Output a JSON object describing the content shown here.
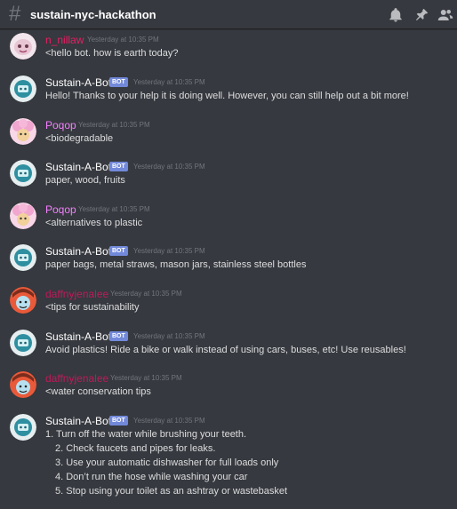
{
  "channel": {
    "name": "sustain-nyc-hackathon"
  },
  "colors": {
    "bot_name": "#ffffff",
    "niliaw": "#e91e63",
    "poqop": "#f47fff",
    "daffny": "#c2185b",
    "bot_badge": "#7289da"
  },
  "icons": [
    "bell-icon",
    "pin-icon",
    "members-icon"
  ],
  "messages": [
    {
      "author": "n_nillaw",
      "time": "Yesterday at 10:35 PM",
      "text": "<hello bot. how is earth today?"
    },
    {
      "author": "Sustain-A-Bot",
      "badge": "BOT",
      "time": "Yesterday at 10:35 PM",
      "text": "Hello! Thanks to your help it is doing well. However, you can still help out a bit more!"
    },
    {
      "author": "Poqop",
      "time": "Yesterday at 10:35 PM",
      "text": "<biodegradable"
    },
    {
      "author": "Sustain-A-Bot",
      "badge": "BOT",
      "time": "Yesterday at 10:35 PM",
      "text": "paper, wood, fruits"
    },
    {
      "author": "Poqop",
      "time": "Yesterday at 10:35 PM",
      "text": "<alternatives to plastic"
    },
    {
      "author": "Sustain-A-Bot",
      "badge": "BOT",
      "time": "Yesterday at 10:35 PM",
      "text": "paper bags, metal straws, mason jars, stainless steel bottles"
    },
    {
      "author": "daffnyjenalee",
      "time": "Yesterday at 10:35 PM",
      "text": "<tips for sustainability"
    },
    {
      "author": "Sustain-A-Bot",
      "badge": "BOT",
      "time": "Yesterday at 10:35 PM",
      "text": "Avoid plastics! Ride a bike or walk instead of using cars, buses, etc! Use reusables!"
    },
    {
      "author": "daffnyjenalee",
      "time": "Yesterday at 10:35 PM",
      "text": "<water conservation tips"
    },
    {
      "author": "Sustain-A-Bot",
      "badge": "BOT",
      "time": "Yesterday at 10:35 PM",
      "lines": [
        "1. Turn off the water while brushing your teeth.",
        "2. Check faucets and pipes for leaks.",
        "3. Use your automatic dishwasher for full loads only",
        "4. Don’t run the hose while washing your car",
        "5. Stop using your toilet as an ashtray or wastebasket"
      ]
    }
  ]
}
